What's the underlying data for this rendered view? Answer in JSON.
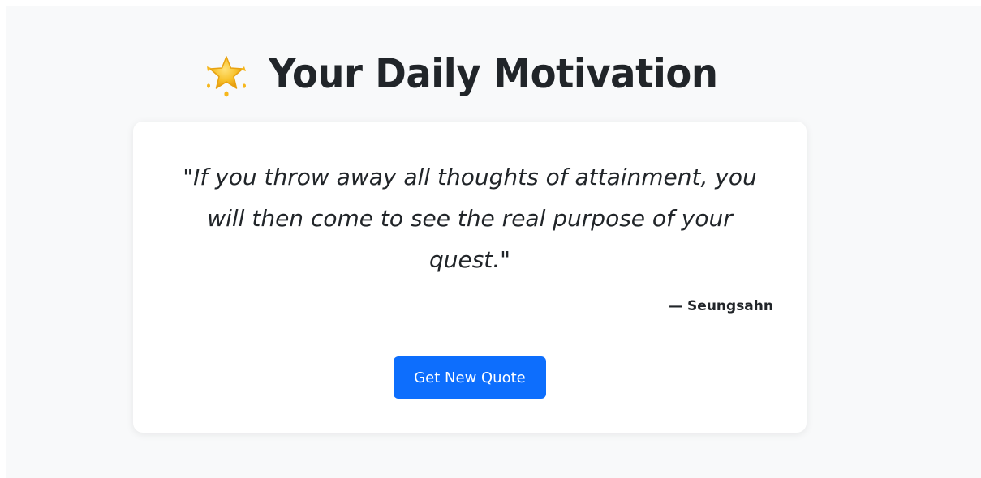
{
  "header": {
    "icon": "glowing-star-icon",
    "title": "Your Daily Motivation"
  },
  "quote_card": {
    "quote_text": "\"If you throw away all thoughts of attainment, you will then come to see the real purpose of your quest.\"",
    "author": "— Seungsahn",
    "button_label": "Get New Quote"
  },
  "colors": {
    "page_background": "#f8f9fa",
    "card_background": "#ffffff",
    "text": "#212529",
    "button": "#0d6efd",
    "star": "#f5b81d"
  }
}
